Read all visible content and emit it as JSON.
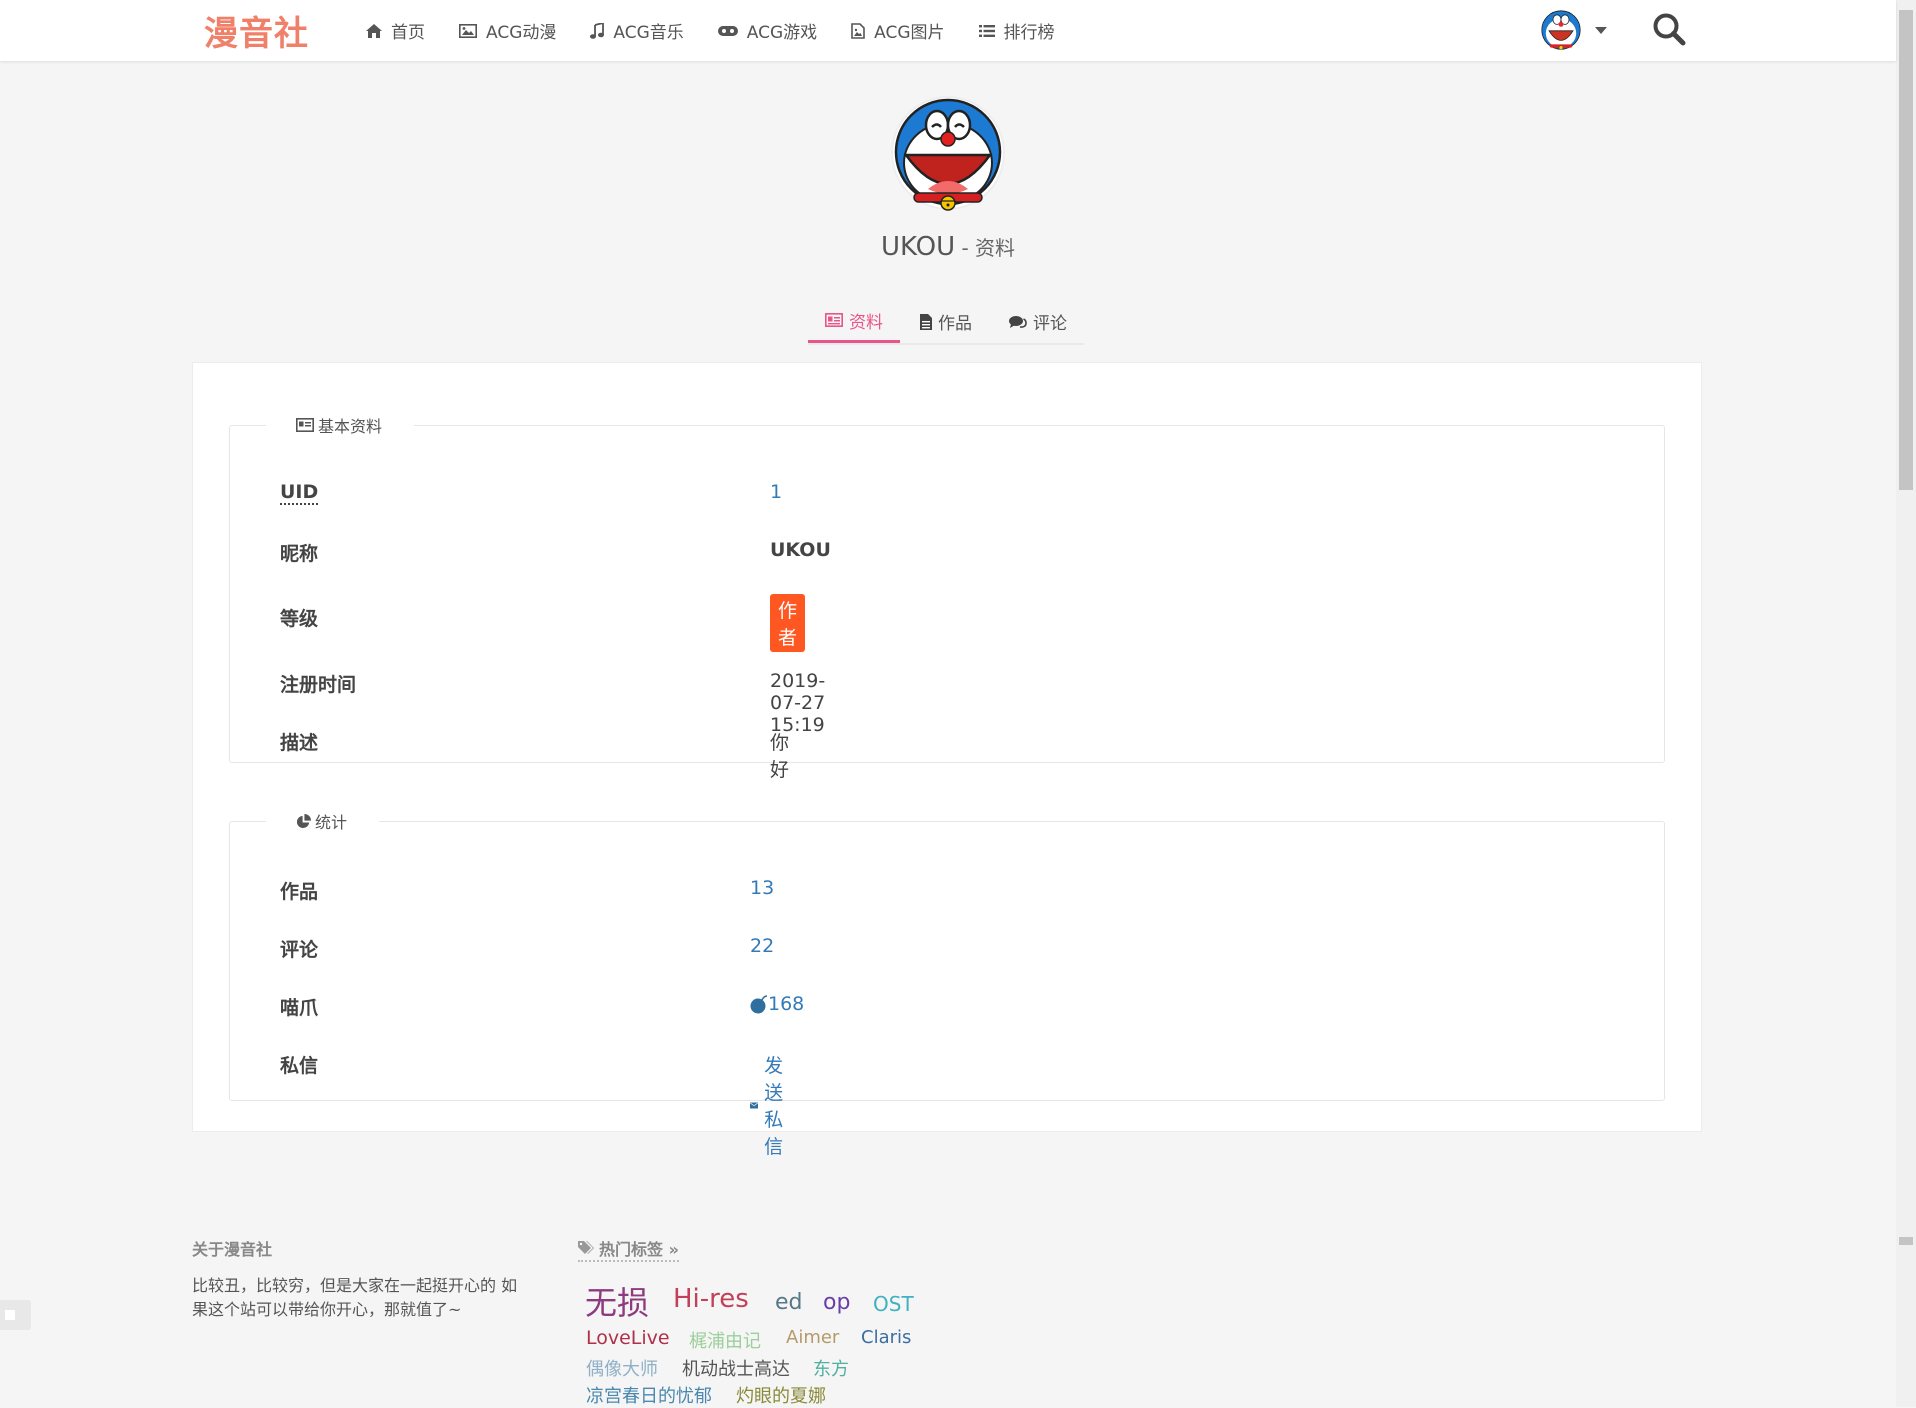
{
  "header": {
    "logo": "漫音社",
    "nav": [
      {
        "label": "首页",
        "icon": "home-icon"
      },
      {
        "label": "ACG动漫",
        "icon": "image-icon"
      },
      {
        "label": "ACG音乐",
        "icon": "music-icon"
      },
      {
        "label": "ACG游戏",
        "icon": "gamepad-icon"
      },
      {
        "label": "ACG图片",
        "icon": "file-image-icon"
      },
      {
        "label": "排行榜",
        "icon": "list-icon"
      }
    ]
  },
  "profile": {
    "name": "UKOU",
    "title_suffix": " - 资料"
  },
  "tabs": [
    {
      "label": "资料",
      "icon": "id-card-icon",
      "active": true
    },
    {
      "label": "作品",
      "icon": "file-icon",
      "active": false
    },
    {
      "label": "评论",
      "icon": "comments-icon",
      "active": false
    }
  ],
  "basic_info": {
    "legend": "基本资料",
    "rows": [
      {
        "label": "UID",
        "value": "1"
      },
      {
        "label": "昵称",
        "value": "UKOU"
      },
      {
        "label": "等级",
        "value": "作者"
      },
      {
        "label": "注册时间",
        "value": "2019-07-27 15:19"
      },
      {
        "label": "描述",
        "value": "你好"
      }
    ]
  },
  "stats": {
    "legend": "统计",
    "rows": [
      {
        "label": "作品",
        "value": "13"
      },
      {
        "label": "评论",
        "value": "22"
      },
      {
        "label": "喵爪",
        "value": "168"
      },
      {
        "label": "私信",
        "value": "发送私信"
      }
    ]
  },
  "footer": {
    "about_title": "关于漫音社",
    "about_text": "比较丑，比较穷，但是大家在一起挺开心的 如果这个站可以带给你开心，那就值了~",
    "tags_title": "热门标签 »",
    "tags": [
      {
        "label": "无损",
        "color": "#8e3a7e"
      },
      {
        "label": "Hi-res",
        "color": "#c2405a"
      },
      {
        "label": "ed",
        "color": "#557788"
      },
      {
        "label": "op",
        "color": "#6a3ea8"
      },
      {
        "label": "OST",
        "color": "#3fb1c0"
      },
      {
        "label": "LoveLive",
        "color": "#b0304a"
      },
      {
        "label": "梶浦由记",
        "color": "#9ccf9c"
      },
      {
        "label": "Aimer",
        "color": "#b59a6a"
      },
      {
        "label": "Claris",
        "color": "#3c6ea0"
      },
      {
        "label": "偶像大师",
        "color": "#8fb0c8"
      },
      {
        "label": "机动战士高达",
        "color": "#555555"
      },
      {
        "label": "东方",
        "color": "#4fb0a0"
      },
      {
        "label": "凉宫春日的忧郁",
        "color": "#4a88b0"
      },
      {
        "label": "灼眼的夏娜",
        "color": "#8a8a3a"
      }
    ]
  }
}
